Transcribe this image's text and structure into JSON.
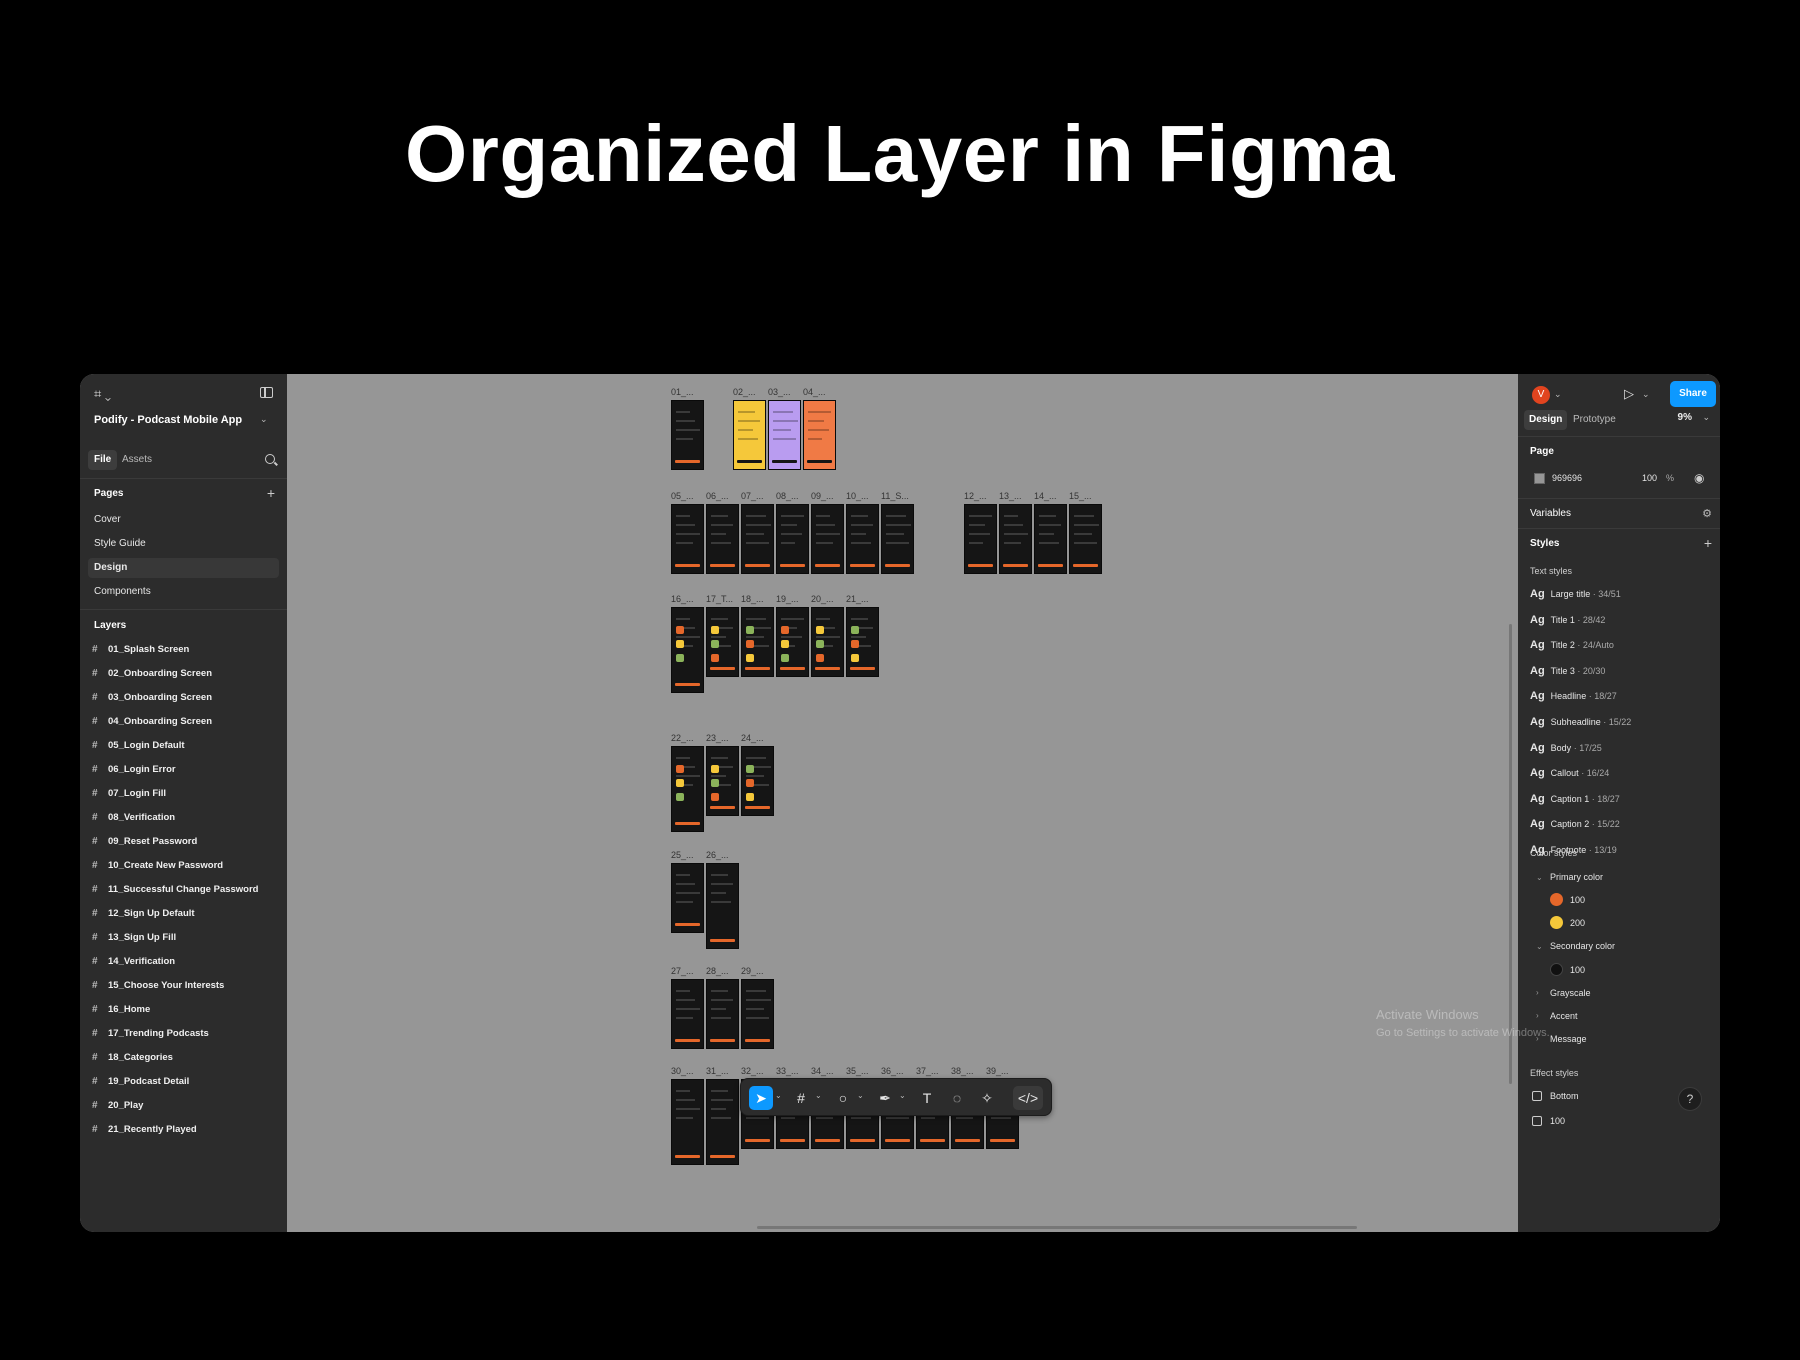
{
  "headline": "Organized Layer in Figma",
  "app": {
    "file_title": "Podify - Podcast Mobile App",
    "tabs": [
      "File",
      "Assets"
    ],
    "pages_label": "Pages",
    "pages": [
      "Cover",
      "Style Guide",
      "Design",
      "Components"
    ],
    "active_page": "Design",
    "layers_label": "Layers",
    "layers": [
      "01_Splash Screen",
      "02_Onboarding Screen",
      "03_Onboarding Screen",
      "04_Onboarding Screen",
      "05_Login Default",
      "06_Login  Error",
      "07_Login Fill",
      "08_Verification",
      "09_Reset Password",
      "10_Create New Password",
      "11_Successful Change Password",
      "12_Sign Up Default",
      "13_Sign Up Fill",
      "14_Verification",
      "15_Choose Your Interests",
      "16_Home",
      "17_Trending Podcasts",
      "18_Categories",
      "19_Podcast Detail",
      "20_Play",
      "21_Recently Played"
    ]
  },
  "canvas": {
    "frame_labels_row1": [
      "01_...",
      "02_...",
      "03_...",
      "04_..."
    ],
    "frame_labels_row2": [
      "05_...",
      "06_...",
      "07_...",
      "08_...",
      "09_...",
      "10_...",
      "11_S...",
      "12_...",
      "13_...",
      "14_...",
      "15_..."
    ],
    "frame_labels_row3": [
      "16_...",
      "17_T...",
      "18_...",
      "19_...",
      "20_...",
      "21_..."
    ],
    "frame_labels_row4": [
      "22_...",
      "23_...",
      "24_..."
    ],
    "frame_labels_row5": [
      "25_...",
      "26_..."
    ],
    "frame_labels_row6": [
      "27_...",
      "28_...",
      "29_..."
    ],
    "frame_labels_row7": [
      "30_...",
      "31_...",
      "32_...",
      "33_...",
      "34_...",
      "35_...",
      "36_...",
      "37_...",
      "38_...",
      "39_..."
    ]
  },
  "right_panel": {
    "avatar_letter": "V",
    "share_label": "Share",
    "tabs": [
      "Design",
      "Prototype"
    ],
    "zoom": "9%",
    "page_label": "Page",
    "page_color": "969696",
    "page_opacity": "100",
    "percent_sign": "%",
    "variables_label": "Variables",
    "styles_label": "Styles",
    "text_styles_label": "Text styles",
    "text_styles": [
      {
        "name": "Large title",
        "spec": "· 34/51"
      },
      {
        "name": "Title 1",
        "spec": "· 28/42"
      },
      {
        "name": "Title 2",
        "spec": "· 24/Auto"
      },
      {
        "name": "Title 3",
        "spec": "· 20/30"
      },
      {
        "name": "Headline",
        "spec": "· 18/27"
      },
      {
        "name": "Subheadline",
        "spec": "· 15/22"
      },
      {
        "name": "Body",
        "spec": "· 17/25"
      },
      {
        "name": "Callout",
        "spec": "· 16/24"
      },
      {
        "name": "Caption 1",
        "spec": "· 18/27"
      },
      {
        "name": "Caption 2",
        "spec": "· 15/22"
      },
      {
        "name": "Footnote",
        "spec": "· 13/19"
      }
    ],
    "ag": "Ag",
    "color_styles_label": "Color styles",
    "primary_color_label": "Primary color",
    "primary_colors": [
      {
        "label": "100",
        "hex": "#e5672a"
      },
      {
        "label": "200",
        "hex": "#f5c83a"
      }
    ],
    "secondary_color_label": "Secondary color",
    "secondary_colors": [
      {
        "label": "100",
        "hex": "#111111"
      }
    ],
    "groups": [
      "Grayscale",
      "Accent",
      "Message"
    ],
    "effect_styles_label": "Effect styles",
    "effects": [
      "Bottom",
      "100"
    ],
    "help": "?"
  },
  "watermark": {
    "line1": "Activate Windows",
    "line2": "Go to Settings to activate Windows."
  }
}
